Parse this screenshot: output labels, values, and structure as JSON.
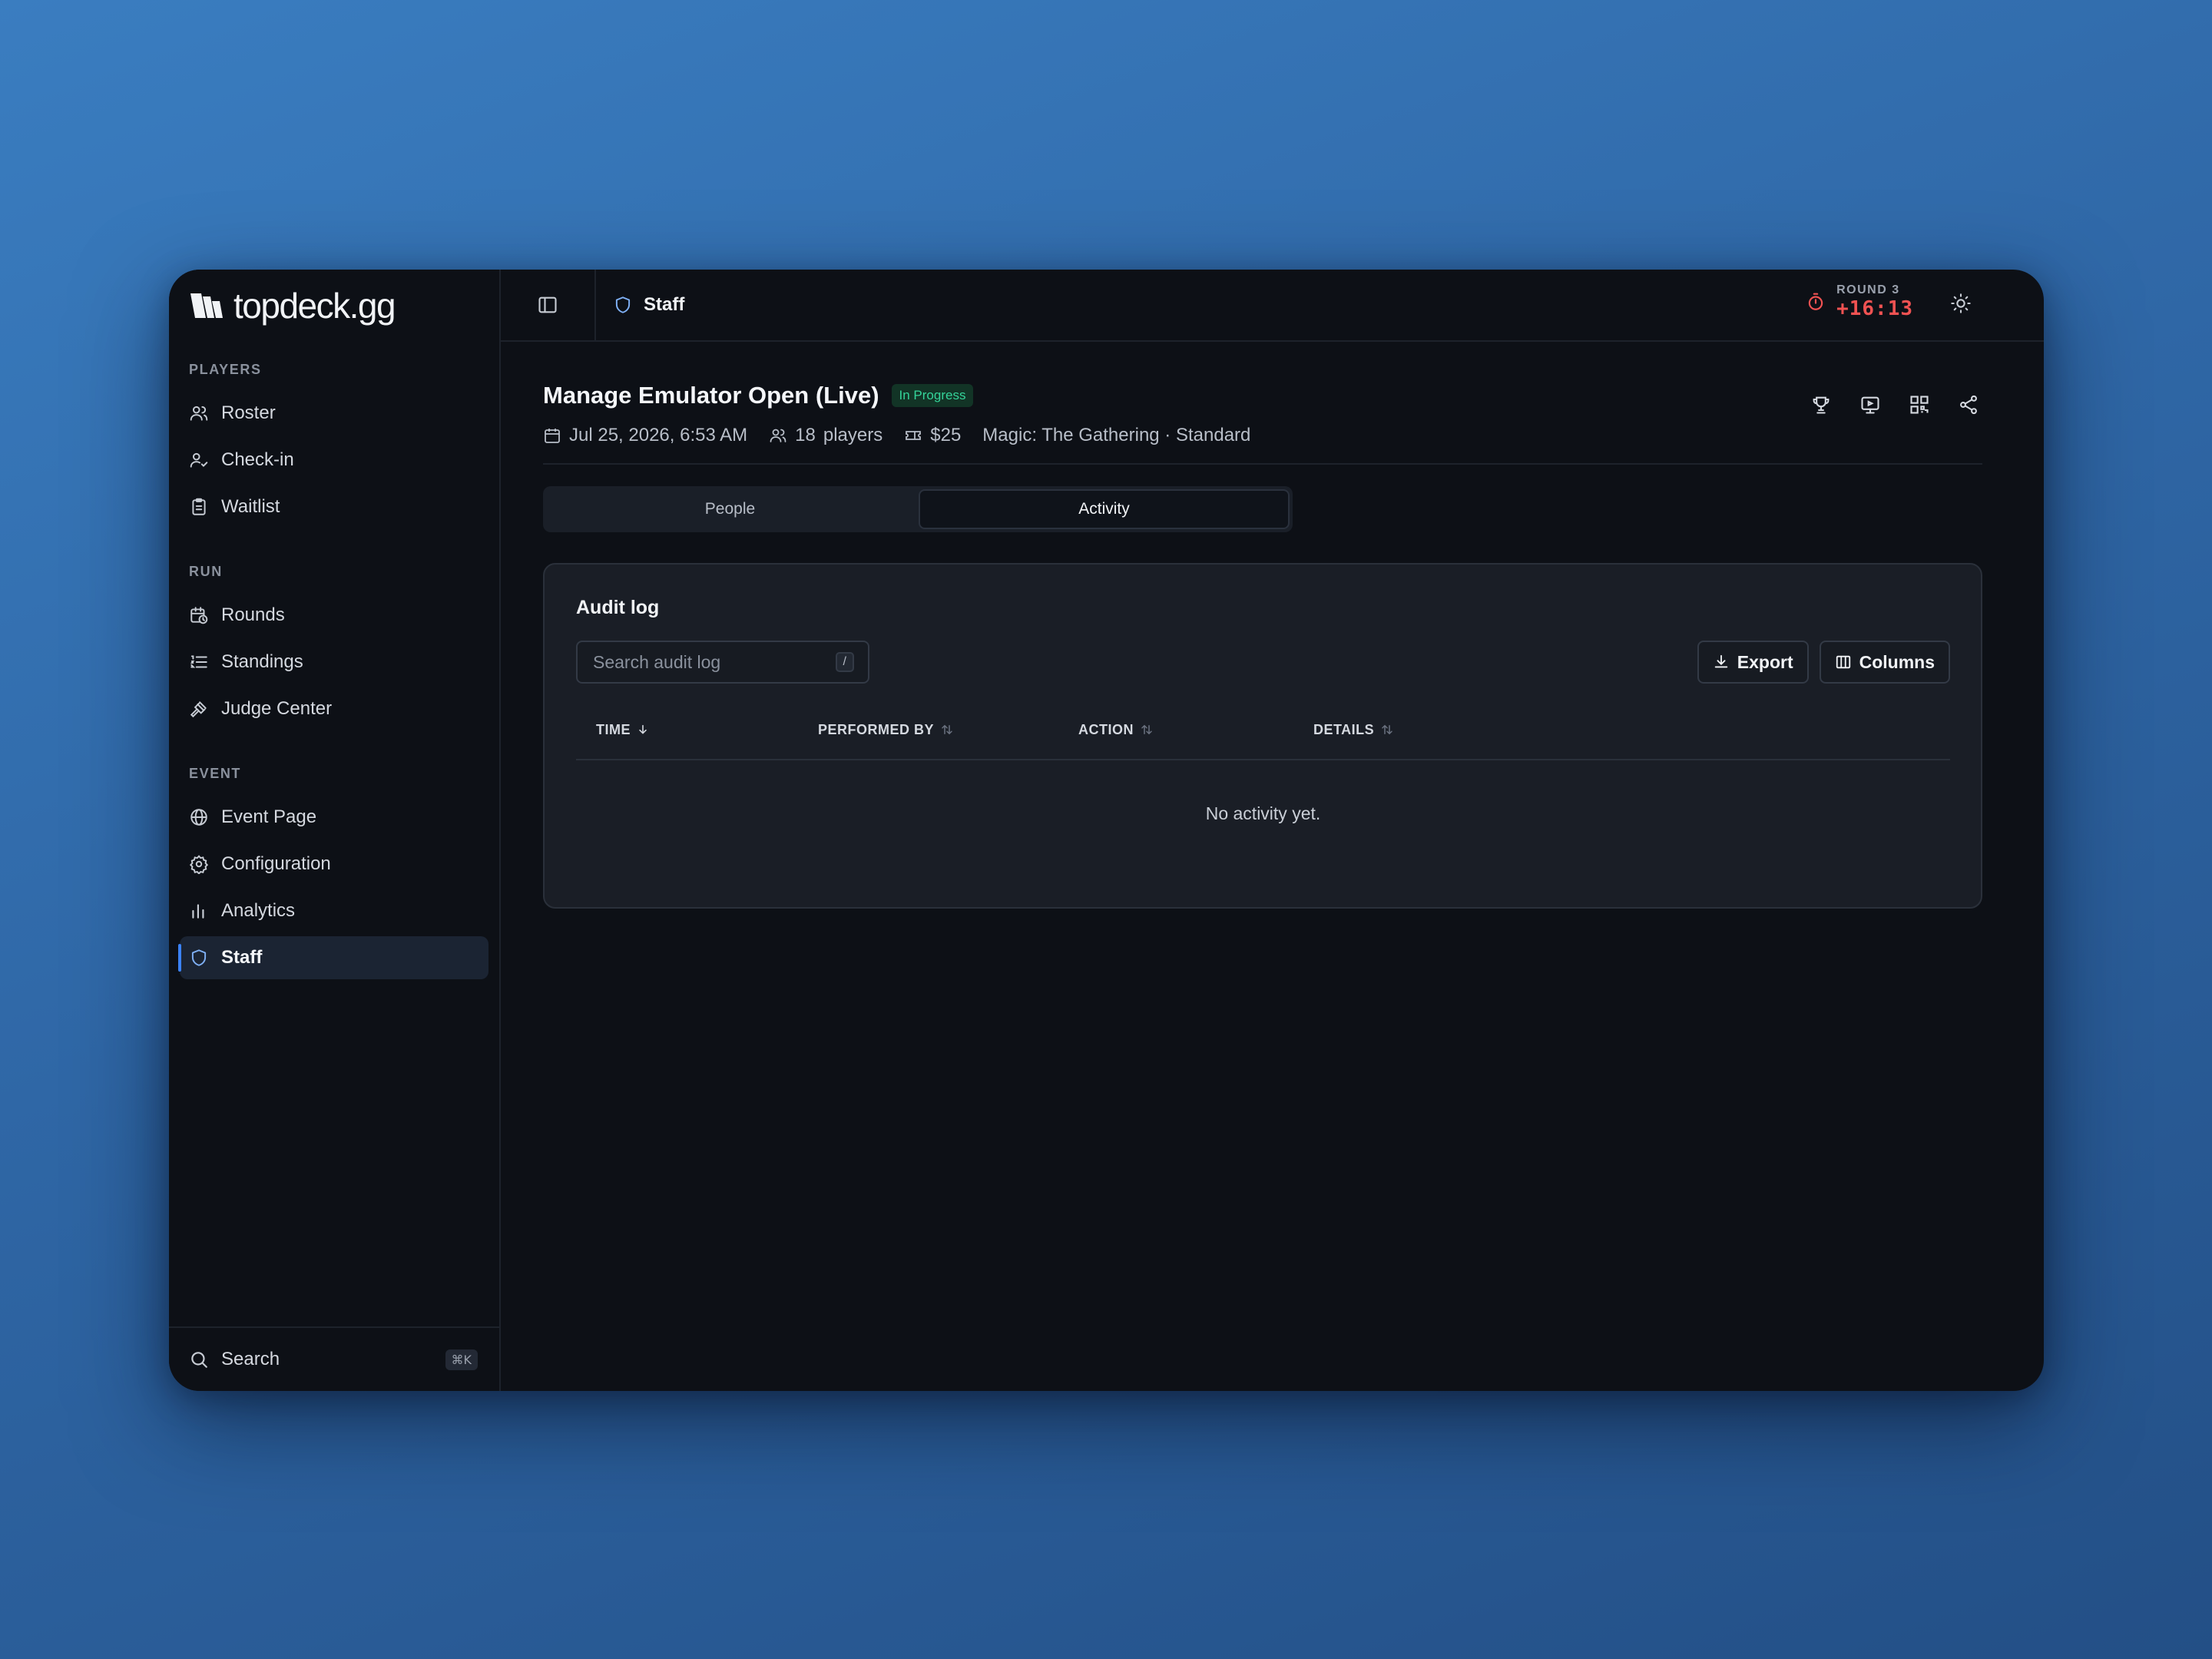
{
  "brand": {
    "name": "topdeck.gg"
  },
  "sidebar": {
    "sections": [
      {
        "label": "PLAYERS",
        "items": [
          {
            "label": "Roster",
            "icon": "users-icon"
          },
          {
            "label": "Check-in",
            "icon": "user-check-icon"
          },
          {
            "label": "Waitlist",
            "icon": "clipboard-icon"
          }
        ]
      },
      {
        "label": "RUN",
        "items": [
          {
            "label": "Rounds",
            "icon": "calendar-clock-icon"
          },
          {
            "label": "Standings",
            "icon": "list-ordered-icon"
          },
          {
            "label": "Judge Center",
            "icon": "gavel-icon"
          }
        ]
      },
      {
        "label": "EVENT",
        "items": [
          {
            "label": "Event Page",
            "icon": "globe-icon"
          },
          {
            "label": "Configuration",
            "icon": "gear-icon"
          },
          {
            "label": "Analytics",
            "icon": "bar-chart-icon"
          },
          {
            "label": "Staff",
            "icon": "shield-icon",
            "active": true
          }
        ]
      }
    ],
    "search": {
      "label": "Search",
      "shortcut": "⌘K"
    }
  },
  "topbar": {
    "breadcrumb": "Staff",
    "round_label": "ROUND 3",
    "round_timer": "+16:13",
    "timer_color": "#f05252"
  },
  "event": {
    "title": "Manage Emulator Open (Live)",
    "status": "In Progress",
    "date": "Jul 25, 2026, 6:53 AM",
    "players": "18",
    "players_unit": "players",
    "fee": "$25",
    "format": "Magic: The Gathering · Standard"
  },
  "tabs": [
    {
      "label": "People",
      "active": false
    },
    {
      "label": "Activity",
      "active": true
    }
  ],
  "audit": {
    "title": "Audit log",
    "search_placeholder": "Search audit log",
    "search_shortcut": "/",
    "export_label": "Export",
    "columns_label": "Columns",
    "headers": {
      "time": "TIME",
      "performed_by": "PERFORMED BY",
      "action": "ACTION",
      "details": "DETAILS"
    },
    "empty": "No activity yet."
  },
  "colors": {
    "accent": "#3b82f6",
    "status_green": "#34d399",
    "background": "#0d1016"
  }
}
